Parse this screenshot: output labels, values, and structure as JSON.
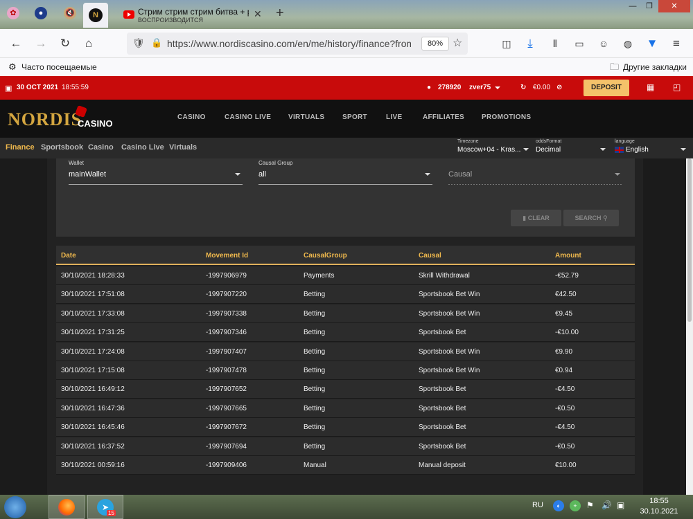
{
  "browser": {
    "tabs": [
      {
        "title": "Стрим стрим стрим битва + р",
        "subtitle": "ВОСПРОИЗВОДИТСЯ"
      }
    ],
    "url": "https://www.nordiscasino.com/en/me/history/finance?from",
    "zoom": "80%",
    "bookmarks": {
      "left": "Часто посещаемые",
      "right": "Другие закладки"
    }
  },
  "site": {
    "topbar": {
      "date": "30 OCT 2021",
      "time": "18:55:59",
      "user_id": "278920",
      "username": "zver75",
      "balance": "€0.00",
      "deposit_label": "DEPOSIT"
    },
    "logo": {
      "main": "NORDIS",
      "sub": "CASINO"
    },
    "nav": [
      "CASINO",
      "CASINO LIVE",
      "VIRTUALS",
      "SPORT",
      "LIVE",
      "AFFILIATES",
      "PROMOTIONS"
    ],
    "subnav": [
      "Finance",
      "Sportsbook",
      "Casino",
      "Casino Live",
      "Virtuals"
    ],
    "settings": {
      "timezone": {
        "label": "Timezone",
        "value": "Moscow+04 - Kras..."
      },
      "odds": {
        "label": "oddsFormat",
        "value": "Decimal"
      },
      "language": {
        "label": "language",
        "value": "English"
      }
    },
    "filters": {
      "wallet": {
        "label": "Wallet",
        "value": "mainWallet"
      },
      "causal_group": {
        "label": "Causal Group",
        "value": "all"
      },
      "causal": {
        "placeholder": "Causal"
      },
      "clear_label": "CLEAR",
      "search_label": "SEARCH"
    },
    "table": {
      "headers": [
        "Date",
        "Movement Id",
        "CausalGroup",
        "Causal",
        "Amount"
      ],
      "rows": [
        [
          "30/10/2021 18:28:33",
          "-1997906979",
          "Payments",
          "Skrill Withdrawal",
          "-€52.79"
        ],
        [
          "30/10/2021 17:51:08",
          "-1997907220",
          "Betting",
          "Sportsbook Bet Win",
          "€42.50"
        ],
        [
          "30/10/2021 17:33:08",
          "-1997907338",
          "Betting",
          "Sportsbook Bet Win",
          "€9.45"
        ],
        [
          "30/10/2021 17:31:25",
          "-1997907346",
          "Betting",
          "Sportsbook Bet",
          "-€10.00"
        ],
        [
          "30/10/2021 17:24:08",
          "-1997907407",
          "Betting",
          "Sportsbook Bet Win",
          "€9.90"
        ],
        [
          "30/10/2021 17:15:08",
          "-1997907478",
          "Betting",
          "Sportsbook Bet Win",
          "€0.94"
        ],
        [
          "30/10/2021 16:49:12",
          "-1997907652",
          "Betting",
          "Sportsbook Bet",
          "-€4.50"
        ],
        [
          "30/10/2021 16:47:36",
          "-1997907665",
          "Betting",
          "Sportsbook Bet",
          "-€0.50"
        ],
        [
          "30/10/2021 16:45:46",
          "-1997907672",
          "Betting",
          "Sportsbook Bet",
          "-€4.50"
        ],
        [
          "30/10/2021 16:37:52",
          "-1997907694",
          "Betting",
          "Sportsbook Bet",
          "-€0.50"
        ],
        [
          "30/10/2021 00:59:16",
          "-1997909406",
          "Manual",
          "Manual deposit",
          "€10.00"
        ]
      ]
    }
  },
  "taskbar": {
    "lang": "RU",
    "badge": "15",
    "time": "18:55",
    "date": "30.10.2021"
  },
  "colors": {
    "red": "#c80b0b",
    "gold": "#f0b94d",
    "deposit": "#f4c26a"
  }
}
